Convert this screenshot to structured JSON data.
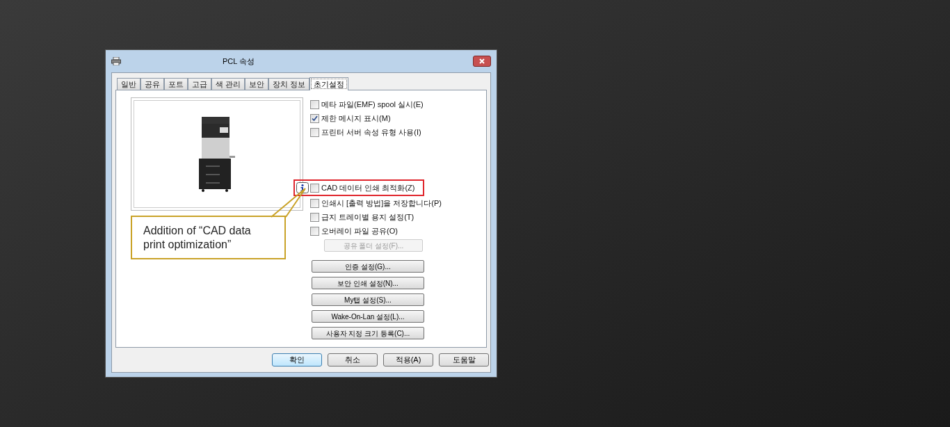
{
  "window": {
    "title": "PCL 속성"
  },
  "tabs": [
    {
      "label": "일반",
      "selected": false
    },
    {
      "label": "공유",
      "selected": false
    },
    {
      "label": "포트",
      "selected": false
    },
    {
      "label": "고급",
      "selected": false
    },
    {
      "label": "색 관리",
      "selected": false
    },
    {
      "label": "보안",
      "selected": false
    },
    {
      "label": "장치 정보",
      "selected": false
    },
    {
      "label": "초기설정",
      "selected": true
    }
  ],
  "callout": {
    "text": "Addition of “CAD data print optimization”"
  },
  "options_top": [
    {
      "label": "메타 파일(EMF) spool 실시(E)",
      "checked": false
    },
    {
      "label": "제한 메시지 표시(M)",
      "checked": true
    },
    {
      "label": "프린터 서버 속성 유형 사용(I)",
      "checked": false
    }
  ],
  "options_bottom": [
    {
      "label": "CAD 데이터 인쇄 최적화(Z)",
      "checked": false,
      "highlighted": true
    },
    {
      "label": "인쇄시 [출력 방법]을 저장합니다(P)",
      "checked": false,
      "highlighted": false
    },
    {
      "label": "급지 트레이별 용지 설정(T)",
      "checked": false,
      "highlighted": false
    },
    {
      "label": "오버레이 파일 공유(O)",
      "checked": false,
      "highlighted": false
    }
  ],
  "shared_folder_button": {
    "label": "공유 폴더 설정(F)...",
    "disabled": true
  },
  "setting_buttons": [
    "인증 설정(G)...",
    "보안 인쇄 설정(N)...",
    "My탭 설정(S)...",
    "Wake-On-Lan 설정(L)...",
    "사용자 지정 크기 등록(C)..."
  ],
  "footer_buttons": [
    {
      "label": "확인",
      "default": true
    },
    {
      "label": "취소",
      "default": false
    },
    {
      "label": "적용(A)",
      "default": false
    },
    {
      "label": "도움말",
      "default": false
    }
  ]
}
